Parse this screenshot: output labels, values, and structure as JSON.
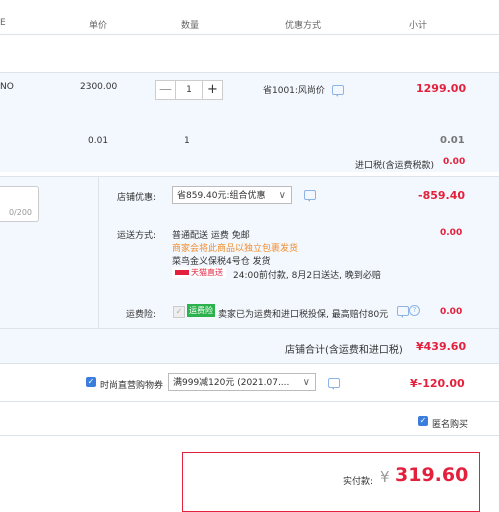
{
  "header": {
    "col_price": "单价",
    "col_qty": "数量",
    "col_promo": "优惠方式",
    "col_subtotal": "小计",
    "col_first_partial": "E"
  },
  "item": {
    "name_partial": "NO",
    "unit_price": "2300.00",
    "quantity": "1",
    "minus_label": "—",
    "plus_label": "+",
    "promo": "省1001:风尚价",
    "subtotal": "1299.00"
  },
  "tax_row": {
    "unit_price": "0.01",
    "quantity": "1",
    "subtotal": "0.01"
  },
  "import_tax": {
    "label": "进口税(含运费税款)",
    "value": "0.00"
  },
  "message_box": {
    "counter": "0/200"
  },
  "shop_discount": {
    "label": "店铺优惠:",
    "selected": "省859.40元:组合优惠",
    "value": "-859.40"
  },
  "shipping": {
    "label": "运送方式:",
    "line1": "普通配送 运费 免邮",
    "line2": "商家会将此商品以独立包裹发货",
    "line3": "菜鸟金义保税4号仓  发货",
    "badge": "天猫直送",
    "line4": "24:00前付款, 8月2日送达, 晚到必赔",
    "value": "0.00"
  },
  "insurance": {
    "label": "运费险:",
    "badge": "运费险",
    "text": "卖家已为运费和进口税投保, 最高赔付80元",
    "value": "0.00"
  },
  "shop_total": {
    "label": "店铺合计(含运费和进口税)",
    "value": "¥439.60"
  },
  "coupon": {
    "label": "时尚直营购物券",
    "selected": "满999减120元 (2021.07....",
    "value": "¥-120.00"
  },
  "anonymous": {
    "label": "匿名购买"
  },
  "payment": {
    "label": "实付款:",
    "currency": "¥",
    "amount": "319.60"
  },
  "colors": {
    "accent_red": "#e4213d",
    "panel_blue": "#f3f8fe",
    "checkbox_blue": "#3b7ddd"
  }
}
